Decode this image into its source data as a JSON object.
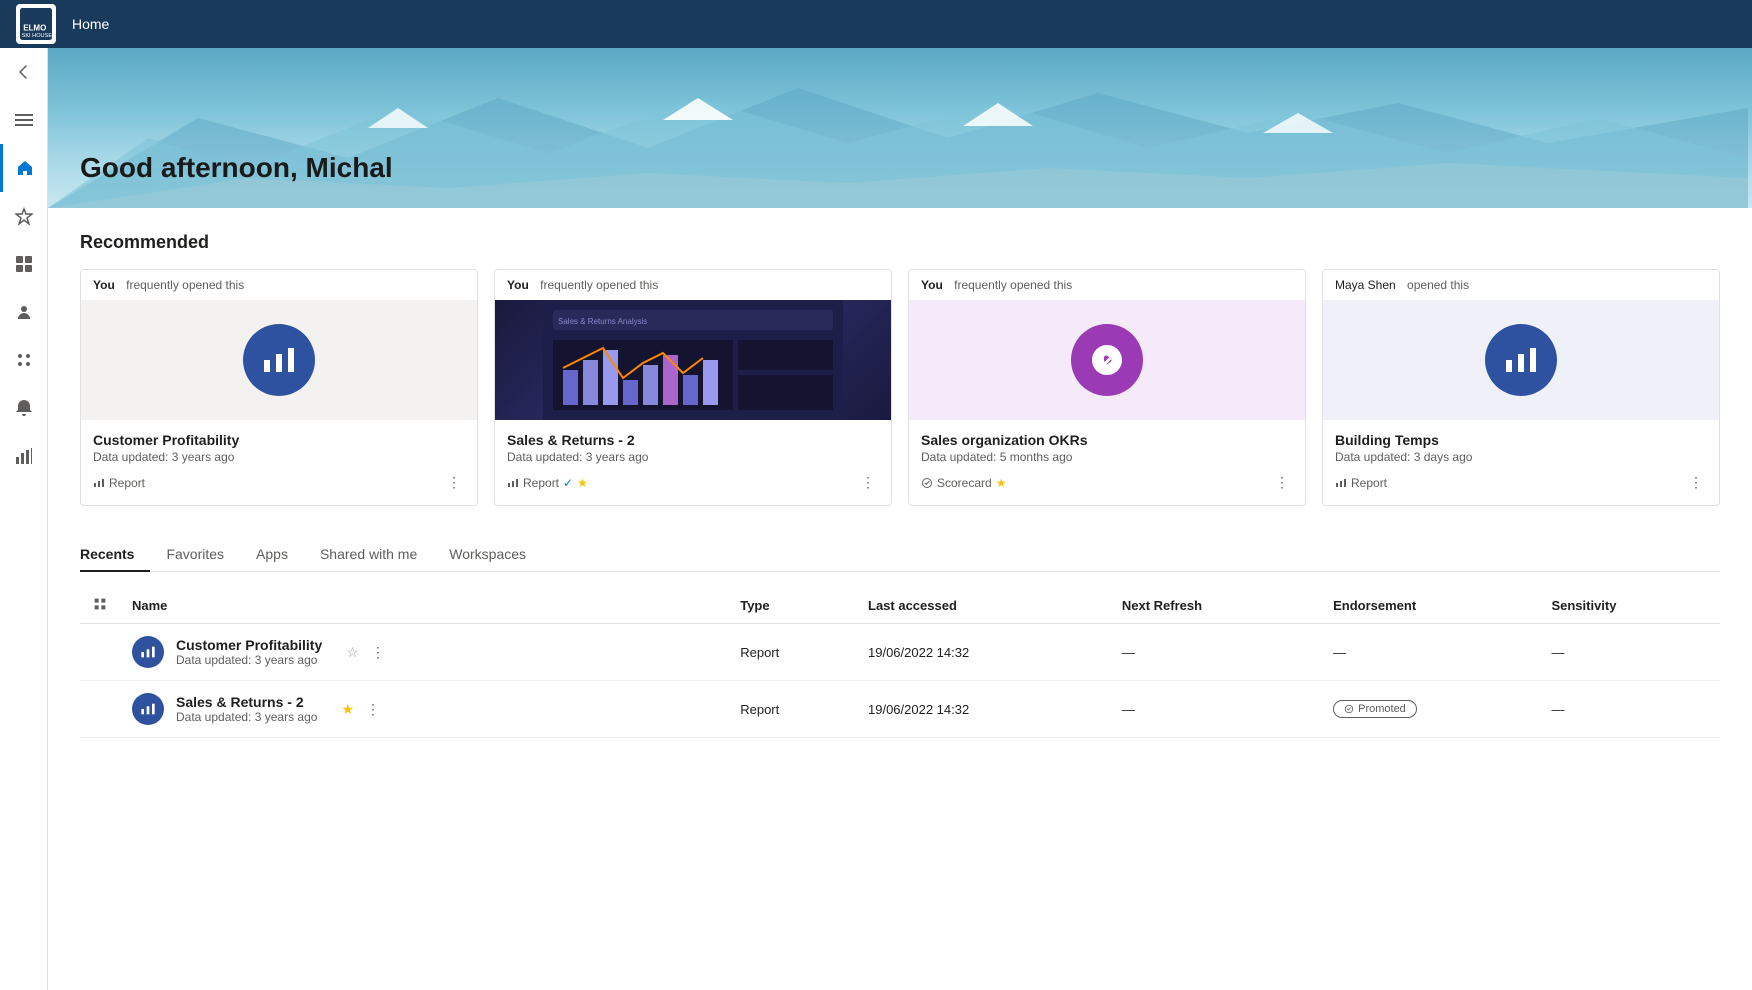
{
  "topbar": {
    "title": "Home"
  },
  "hero": {
    "greeting": "Good afternoon, Michal"
  },
  "recommended": {
    "section_title": "Recommended",
    "cards": [
      {
        "id": "card1",
        "context": "You",
        "context_suffix": "frequently opened this",
        "name": "Customer Profitability",
        "updated": "Data updated: 3 years ago",
        "type": "Report",
        "has_image": false,
        "icon_color": "#2f52a0",
        "starred": false,
        "endorsed": false
      },
      {
        "id": "card2",
        "context": "You",
        "context_suffix": "frequently opened this",
        "name": "Sales & Returns  - 2",
        "updated": "Data updated: 3 years ago",
        "type": "Report",
        "has_image": true,
        "icon_color": "#2f52a0",
        "starred": true,
        "endorsed": true
      },
      {
        "id": "card3",
        "context": "You",
        "context_suffix": "frequently opened this",
        "name": "Sales organization OKRs",
        "updated": "Data updated: 5 months ago",
        "type": "Scorecard",
        "has_image": false,
        "icon_color": "#9b3ab5",
        "starred": true,
        "endorsed": false
      },
      {
        "id": "card4",
        "context": "Maya Shen",
        "context_suffix": "opened this",
        "name": "Building Temps",
        "updated": "Data updated: 3 days ago",
        "type": "Report",
        "has_image": false,
        "icon_color": "#2f52a0",
        "starred": false,
        "endorsed": false
      }
    ]
  },
  "tabs": {
    "items": [
      "Recents",
      "Favorites",
      "Apps",
      "Shared with me",
      "Workspaces"
    ],
    "active": "Recents"
  },
  "table": {
    "columns": [
      "",
      "Name",
      "Type",
      "Last accessed",
      "Next Refresh",
      "Endorsement",
      "Sensitivity"
    ],
    "rows": [
      {
        "icon_color": "#2f52a0",
        "name": "Customer Profitability",
        "updated": "Data updated: 3 years ago",
        "type": "Report",
        "last_accessed": "19/06/2022 14:32",
        "next_refresh": "—",
        "endorsement": "—",
        "sensitivity": "—",
        "starred": false,
        "promoted": false
      },
      {
        "icon_color": "#2f52a0",
        "name": "Sales & Returns  - 2",
        "updated": "Data updated: 3 years ago",
        "type": "Report",
        "last_accessed": "19/06/2022 14:32",
        "next_refresh": "—",
        "endorsement": "Promoted",
        "sensitivity": "—",
        "starred": true,
        "promoted": true
      }
    ]
  },
  "sidebar": {
    "items": [
      {
        "label": "Back",
        "icon": "back"
      },
      {
        "label": "Menu",
        "icon": "menu"
      },
      {
        "label": "Home",
        "icon": "home",
        "active": true
      },
      {
        "label": "Favorites",
        "icon": "star"
      },
      {
        "label": "Browse",
        "icon": "browse"
      },
      {
        "label": "People",
        "icon": "people"
      },
      {
        "label": "Apps",
        "icon": "apps"
      },
      {
        "label": "Notifications",
        "icon": "bell"
      },
      {
        "label": "Metrics",
        "icon": "metrics"
      }
    ]
  }
}
